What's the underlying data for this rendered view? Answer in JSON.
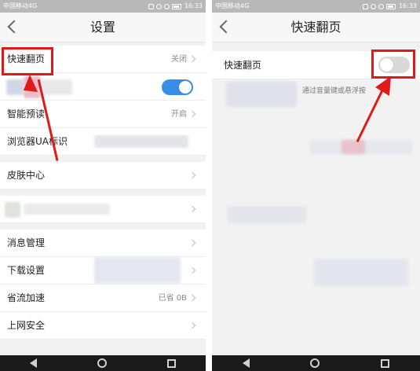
{
  "status_bar": {
    "carrier": "中国移动4G",
    "time": "16:33"
  },
  "left_screen": {
    "title": "设置",
    "rows": [
      {
        "label": "快速翻页",
        "value": "关闭"
      },
      {
        "label": ""
      },
      {
        "label": "智能预读",
        "value": "开启"
      },
      {
        "label": "浏览器UA标识"
      },
      {
        "label": "皮肤中心"
      },
      {
        "label": ""
      },
      {
        "label": "消息管理"
      },
      {
        "label": "下载设置"
      },
      {
        "label": "省流加速",
        "value": "已省 0B"
      },
      {
        "label": "上网安全"
      }
    ]
  },
  "right_screen": {
    "title": "快速翻页",
    "row_label": "快速翻页",
    "description": "通过音量键或悬浮按"
  },
  "annotation_color": "#e01919",
  "toggle_on_color": "#3a8ee6"
}
